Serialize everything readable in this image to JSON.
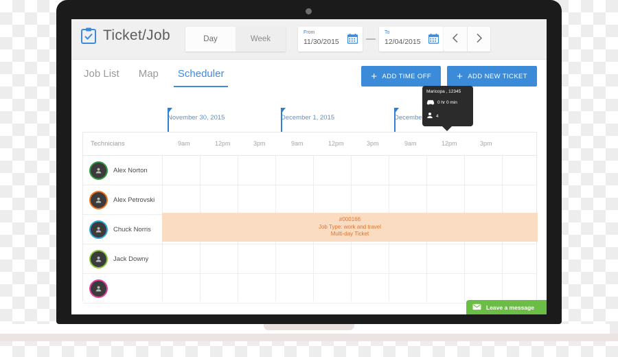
{
  "app": {
    "title": "Ticket/Job",
    "icon": "clipboard-check-icon"
  },
  "toolbar": {
    "view_modes": [
      {
        "label": "Day",
        "active": true
      },
      {
        "label": "Week",
        "active": false
      }
    ],
    "date_from": {
      "label": "From",
      "value": "11/30/2015",
      "icon": "calendar-icon"
    },
    "date_to": {
      "label": "To",
      "value": "12/04/2015",
      "icon": "calendar-icon"
    },
    "prev_icon": "chevron-left-icon",
    "next_icon": "chevron-right-icon"
  },
  "tabs": [
    {
      "label": "Job List",
      "active": false
    },
    {
      "label": "Map",
      "active": false
    },
    {
      "label": "Scheduler",
      "active": true
    }
  ],
  "actions": [
    {
      "label": "ADD TIME OFF",
      "icon": "plus-icon"
    },
    {
      "label": "ADD NEW TICKET",
      "icon": "plus-icon"
    }
  ],
  "scheduler": {
    "technicians_header": "Technicians",
    "days": [
      {
        "date": "November 30, 2015",
        "times": [
          "9am",
          "12pm",
          "3pm"
        ]
      },
      {
        "date": "December 1, 2015",
        "times": [
          "9am",
          "12pm",
          "3pm"
        ]
      },
      {
        "date": "December 2, 2015",
        "times": [
          "9am",
          "12pm",
          "3pm"
        ]
      }
    ],
    "technicians": [
      {
        "name": "Alex Norton",
        "ring_color": "#2f9e3f"
      },
      {
        "name": "Alex Petrovski",
        "ring_color": "#ef7222"
      },
      {
        "name": "Chuck Norris",
        "ring_color": "#2fa8e0"
      },
      {
        "name": "Jack Downy",
        "ring_color": "#8cc63f"
      },
      {
        "name": "",
        "ring_color": "#e83fa6"
      }
    ],
    "ticket": {
      "id": "#000166",
      "job_type": "Job Type: work and travel",
      "duration": "Multi-day Ticket",
      "fill_color": "#fadcc3",
      "text_color": "#e0762a"
    },
    "tooltip": {
      "location": "Maricopa , 12345",
      "travel_time": "0 hr 0 min",
      "travel_icon": "car-icon",
      "people_count": "4",
      "people_icon": "person-icon"
    }
  },
  "chat": {
    "label": "Leave a message",
    "icon": "envelope-icon",
    "color": "#6cbd45"
  },
  "colors": {
    "accent_blue": "#3c8bd9",
    "day_marker_blue": "#2f7fd6",
    "ticket_orange": "#e0762a",
    "chat_green": "#6cbd45"
  }
}
